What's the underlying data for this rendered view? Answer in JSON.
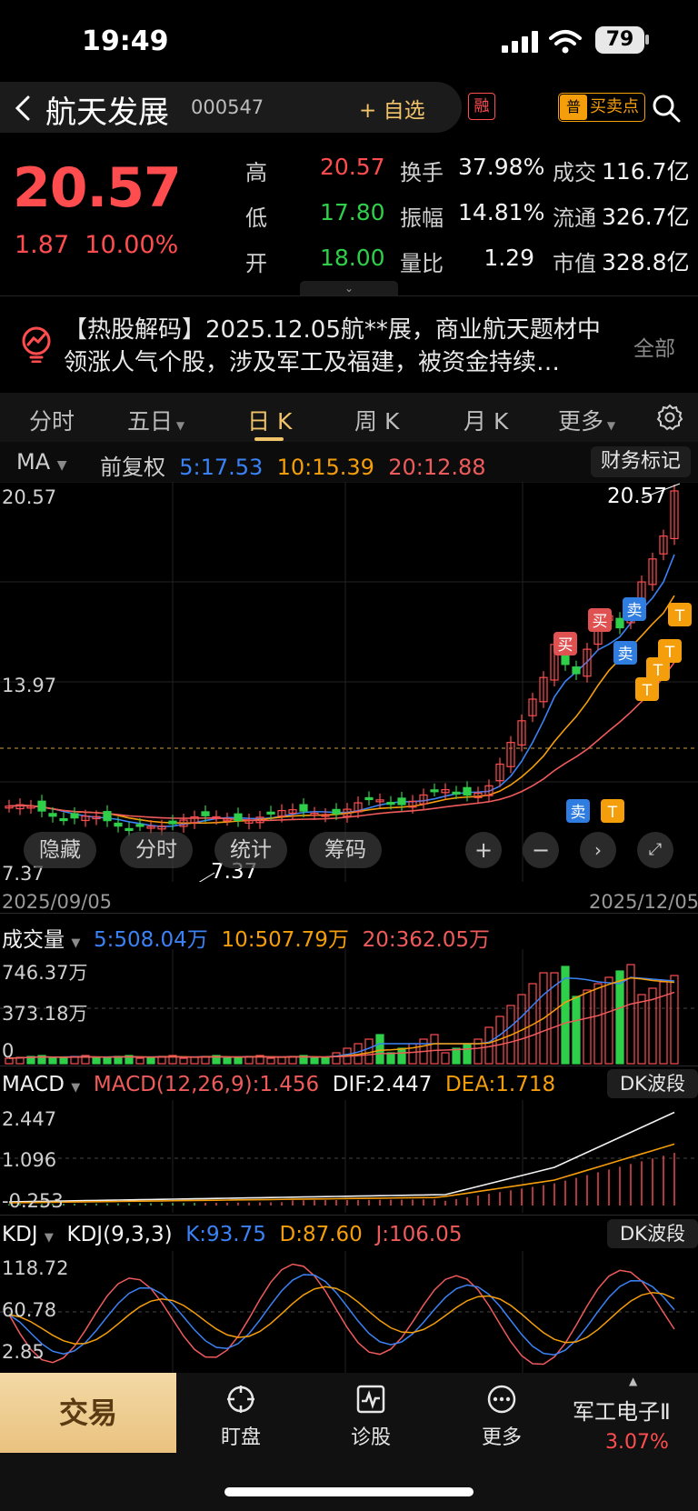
{
  "status_bar": {
    "time": "19:49",
    "battery": "79"
  },
  "header": {
    "stock_name": "航天发展",
    "stock_code": "000547",
    "watch_label": "+ 自选",
    "rong_badge": "融",
    "buysell_tag": "普",
    "buysell_label": "买卖点"
  },
  "quote": {
    "price": "20.57",
    "change": "1.87",
    "change_pct": "10.00%",
    "rows": [
      {
        "l1": "高",
        "v1": "20.57",
        "c1": "red",
        "l2": "换手",
        "v2": "37.98%",
        "l3": "成交",
        "v3": "116.7亿"
      },
      {
        "l1": "低",
        "v1": "17.80",
        "c1": "green",
        "l2": "振幅",
        "v2": "14.81%",
        "l3": "流通",
        "v3": "326.7亿"
      },
      {
        "l1": "开",
        "v1": "18.00",
        "c1": "green",
        "l2": "量比",
        "v2": "1.29",
        "l3": "市值",
        "v3": "328.8亿"
      }
    ]
  },
  "news": {
    "text": "【热股解码】2025.12.05航**展，商业航天题材中领涨人气个股，涉及军工及福建，被资金持续…",
    "all_label": "全部"
  },
  "tabs": [
    {
      "label": "分时",
      "active": false
    },
    {
      "label": "五日",
      "active": false,
      "caret": true
    },
    {
      "label": "日 K",
      "active": true
    },
    {
      "label": "周 K",
      "active": false
    },
    {
      "label": "月 K",
      "active": false
    },
    {
      "label": "更多",
      "active": false,
      "caret": true
    }
  ],
  "ma": {
    "label": "MA",
    "adjust": "前复权",
    "ma5": "5:17.53",
    "ma10": "10:15.39",
    "ma20": "20:12.88",
    "finance_label": "财务标记"
  },
  "kline": {
    "y_top": "20.57",
    "y_mid": "13.97",
    "y_low": "7.37",
    "high_marker": "20.57",
    "low_marker": "7.37",
    "date_start": "2025/09/05",
    "date_end": "2025/12/05",
    "buttons": [
      "隐藏",
      "分时",
      "统计",
      "筹码"
    ],
    "signals": {
      "buy": "买",
      "sell": "卖",
      "t": "T"
    }
  },
  "volume": {
    "label": "成交量",
    "ma5": "5:508.04万",
    "ma10": "10:507.79万",
    "ma20": "20:362.05万",
    "y_top": "746.37万",
    "y_mid": "373.18万",
    "y_zero": "0"
  },
  "macd": {
    "label": "MACD",
    "params": "MACD(12,26,9):1.456",
    "dif": "DIF:2.447",
    "dea": "DEA:1.718",
    "y_top": "2.447",
    "y_mid": "1.096",
    "y_low": "-0.253",
    "dk_label": "DK波段"
  },
  "kdj": {
    "label": "KDJ",
    "params": "KDJ(9,3,3)",
    "k": "K:93.75",
    "d": "D:87.60",
    "j": "J:106.05",
    "y_top": "118.72",
    "y_mid": "60.78",
    "y_low": "2.85",
    "dk_label": "DK波段"
  },
  "bottom_nav": {
    "trade": "交易",
    "items": [
      "盯盘",
      "诊股",
      "更多"
    ],
    "sector_name": "军工电子Ⅱ",
    "sector_pct": "3.07%"
  },
  "colors": {
    "up": "#ff4d4f",
    "down": "#2fcf4a",
    "ma5": "#3b82f6",
    "ma10": "#f59e0b",
    "ma20": "#ef5b5b",
    "accent": "#f2c46a"
  }
}
